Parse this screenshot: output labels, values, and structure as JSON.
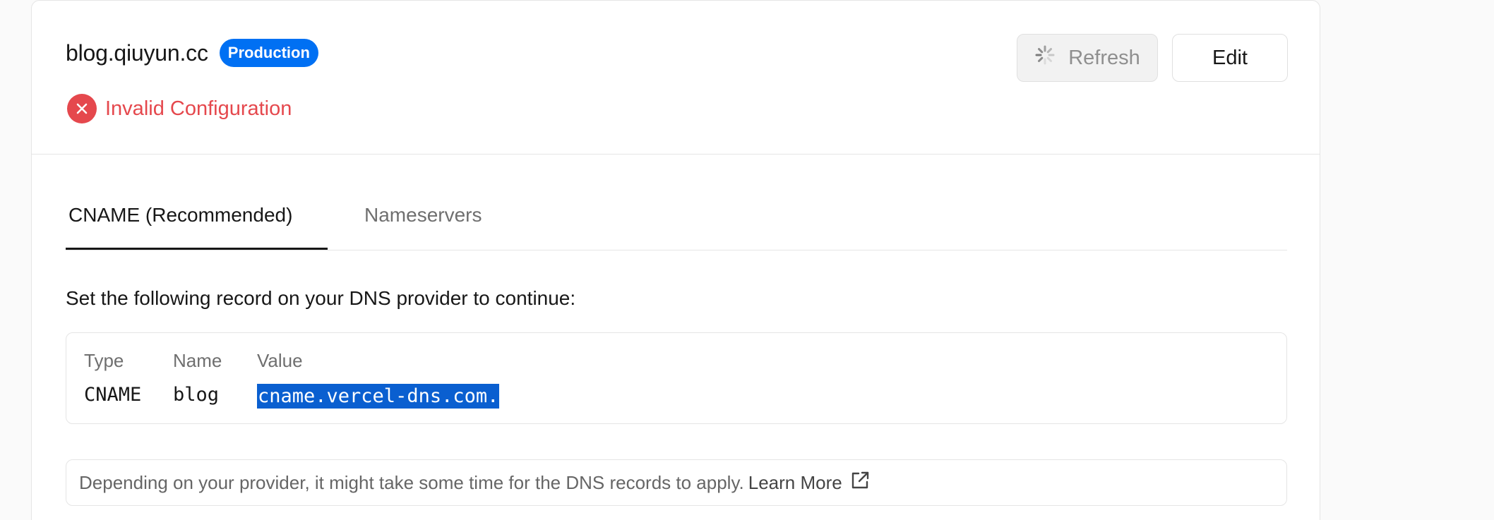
{
  "header": {
    "domain": "blog.qiuyun.cc",
    "badge": "Production",
    "status": "Invalid Configuration",
    "refresh_label": "Refresh",
    "edit_label": "Edit"
  },
  "tabs": [
    {
      "label": "CNAME (Recommended)",
      "active": true
    },
    {
      "label": "Nameservers",
      "active": false
    }
  ],
  "instructions": "Set the following record on your DNS provider to continue:",
  "record": {
    "headers": [
      "Type",
      "Name",
      "Value"
    ],
    "type": "CNAME",
    "name": "blog",
    "value": "cname.vercel-dns.com."
  },
  "note": {
    "text": "Depending on your provider, it might take some time for the DNS records to apply.",
    "link": "Learn More"
  },
  "colors": {
    "accent": "#0070f3",
    "error": "#e5484d",
    "selection": "#0a5fd0"
  }
}
